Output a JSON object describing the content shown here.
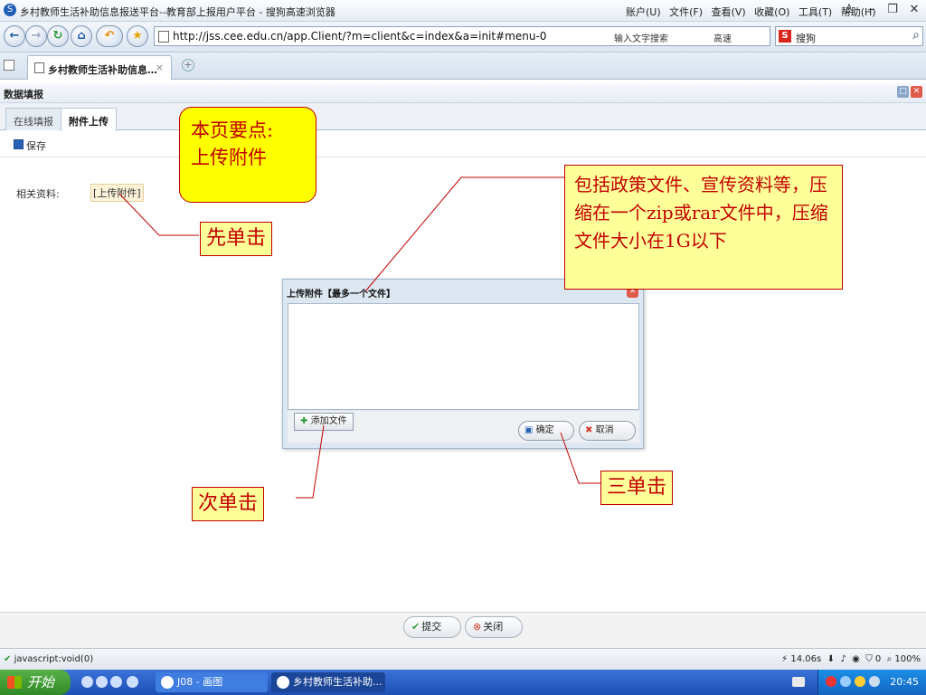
{
  "browser": {
    "window_title": "乡村教师生活补助信息报送平台--教育部上报用户平台 - 搜狗高速浏览器",
    "menu": [
      "账户(U)",
      "文件(F)",
      "查看(V)",
      "收藏(O)",
      "工具(T)",
      "帮助(H)"
    ],
    "url": "http://jss.cee.edu.cn/app.Client/?m=client&c=index&a=init#menu-0",
    "search_hint": "输入文字搜索",
    "speed_label": "高速",
    "search_engine": "搜狗",
    "tab_label": "乡村教师生活补助信息…",
    "status_text": "javascript:void(0)",
    "status_timing": "14.06s",
    "status_zoom": "100%",
    "status_count": "0"
  },
  "page": {
    "panel_title": "数据填报",
    "tabs": [
      "在线填报",
      "附件上传"
    ],
    "save_label": "保存",
    "field_label": "相关资料:",
    "upload_link": "[上传附件]",
    "submit_label": "提交",
    "close_label": "关闭"
  },
  "dialog": {
    "title": "上传附件【最多一个文件】",
    "add_file_label": "添加文件",
    "ok_label": "确定",
    "cancel_label": "取消"
  },
  "annotations": {
    "bubble_line1": "本页要点:",
    "bubble_line2": "上传附件",
    "step1": "先单击",
    "step2": "次单击",
    "step3": "三单击",
    "note": "包括政策文件、宣传资料等，压缩在一个zip或rar文件中，压缩文件大小在1G以下"
  },
  "taskbar": {
    "start_label": "开始",
    "tasks": [
      "J08 - 画图",
      "乡村教师生活补助..."
    ],
    "clock": "20:45"
  },
  "colors": {
    "callout_bg": "#ffff99",
    "callout_text": "#c00000",
    "bubble_bg": "#ffff00",
    "taskbar": "#1d4fb4"
  }
}
